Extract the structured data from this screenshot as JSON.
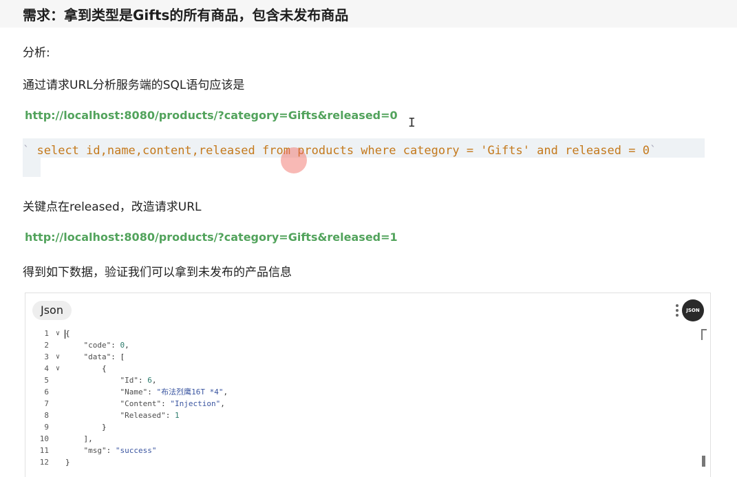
{
  "title": "需求：拿到类型是Gifts的所有商品，包含未发布商品",
  "paragraphs": {
    "analysis": "分析:",
    "sql_intro": "通过请求URL分析服务端的SQL语句应该是",
    "key_point": "关键点在released，改造请求URL",
    "result": "得到如下数据，验证我们可以拿到未发布的产品信息"
  },
  "urls": {
    "original": "http://localhost:8080/products/?category=Gifts&released=0",
    "modified": "http://localhost:8080/products/?category=Gifts&released=1"
  },
  "sql": {
    "backtick": "`",
    "statement": "select id,name,content,released from products where category = 'Gifts' and released = 0"
  },
  "code_block": {
    "language": "Json",
    "badge": "JSON",
    "lines": [
      {
        "num": "1",
        "fold": true,
        "key": "",
        "sep": "",
        "value": "",
        "vtype": "",
        "indent": "",
        "raw": "{"
      },
      {
        "num": "2",
        "fold": false,
        "indent": "    ",
        "key": "\"code\"",
        "sep": ": ",
        "value": "0",
        "vtype": "num",
        "tail": ","
      },
      {
        "num": "3",
        "fold": true,
        "indent": "    ",
        "key": "\"data\"",
        "sep": ": ",
        "value": "[",
        "vtype": "",
        "tail": ""
      },
      {
        "num": "4",
        "fold": true,
        "indent": "        ",
        "raw": "{"
      },
      {
        "num": "5",
        "fold": false,
        "indent": "            ",
        "key": "\"Id\"",
        "sep": ": ",
        "value": "6",
        "vtype": "num",
        "tail": ","
      },
      {
        "num": "6",
        "fold": false,
        "indent": "            ",
        "key": "\"Name\"",
        "sep": ": ",
        "value": "\"布法烈鹰16T *4\"",
        "vtype": "str",
        "tail": ","
      },
      {
        "num": "7",
        "fold": false,
        "indent": "            ",
        "key": "\"Content\"",
        "sep": ": ",
        "value": "\"Injection\"",
        "vtype": "str",
        "tail": ","
      },
      {
        "num": "8",
        "fold": false,
        "indent": "            ",
        "key": "\"Released\"",
        "sep": ": ",
        "value": "1",
        "vtype": "num",
        "tail": ""
      },
      {
        "num": "9",
        "fold": false,
        "indent": "        ",
        "raw": "}"
      },
      {
        "num": "10",
        "fold": false,
        "indent": "    ",
        "raw": "],"
      },
      {
        "num": "11",
        "fold": false,
        "indent": "    ",
        "key": "\"msg\"",
        "sep": ": ",
        "value": "\"success\"",
        "vtype": "str",
        "tail": ""
      },
      {
        "num": "12",
        "fold": false,
        "indent": "",
        "raw": "}"
      }
    ]
  },
  "colors": {
    "link": "#52a35c",
    "sql_text": "#c4791c",
    "sql_background": "#eef2f5"
  }
}
